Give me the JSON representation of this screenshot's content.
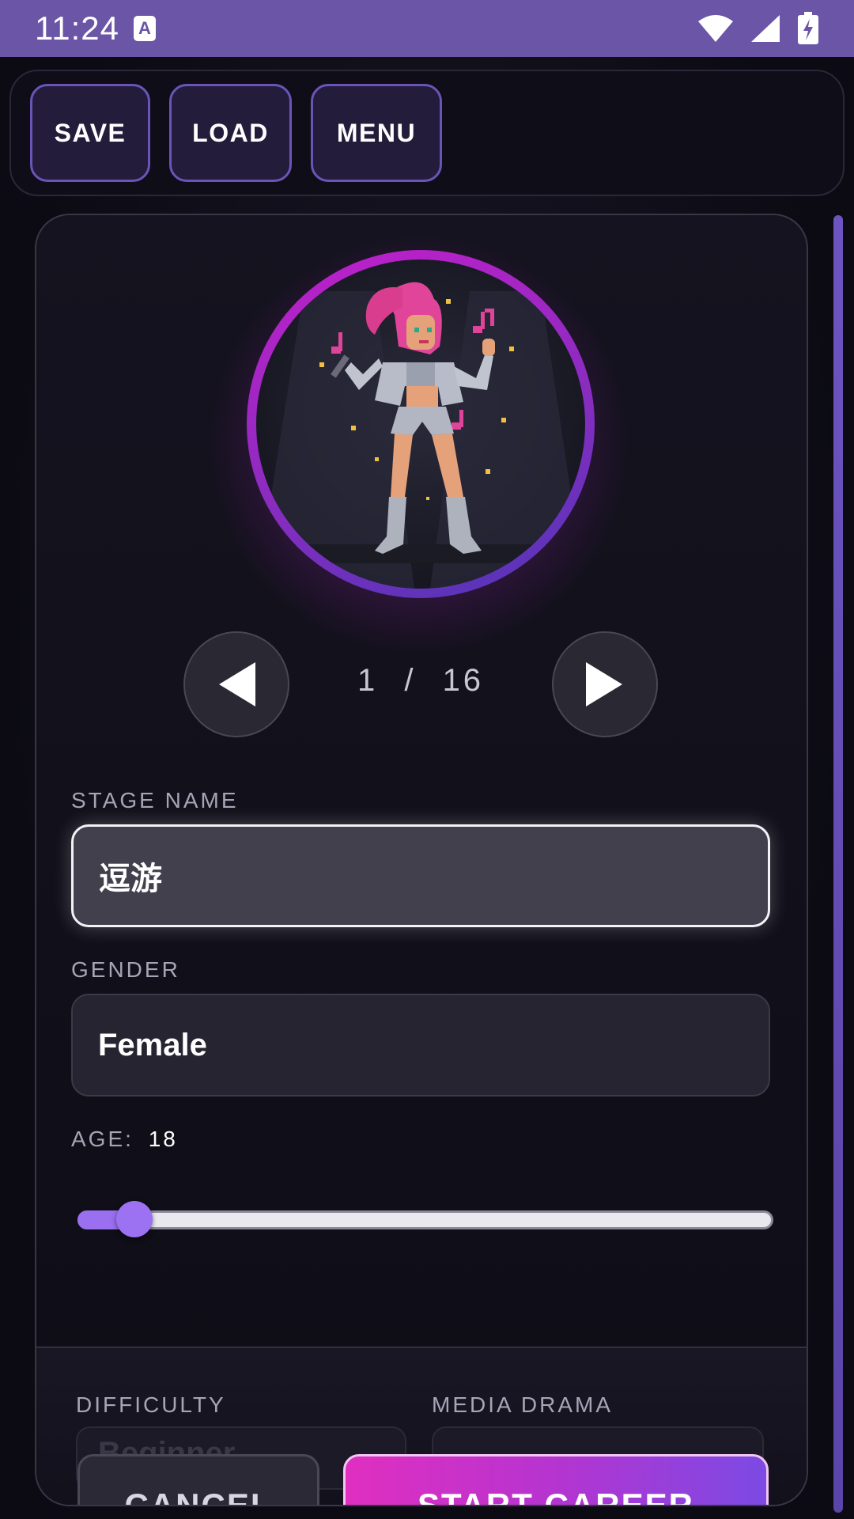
{
  "status_bar": {
    "time": "11:24",
    "notification_icon_letter": "A",
    "icons": [
      "wifi-icon",
      "signal-icon",
      "battery-charging-icon"
    ]
  },
  "toolbar": {
    "save_label": "SAVE",
    "load_label": "LOAD",
    "menu_label": "MENU"
  },
  "character": {
    "current_index": "1",
    "separator": "/",
    "total": "16"
  },
  "form": {
    "stage_name_label": "STAGE NAME",
    "stage_name_value": "逗游",
    "gender_label": "GENDER",
    "gender_value": "Female",
    "age_label": "AGE:",
    "age_value": "18",
    "age_slider_fraction": 0.07
  },
  "options": {
    "difficulty_label": "DIFFICULTY",
    "difficulty_value": "Beginner",
    "media_drama_label": "MEDIA DRAMA"
  },
  "actions": {
    "cancel_label": "CANCEL",
    "start_label": "START CAREER"
  },
  "colors": {
    "status_bar": "#6a55a6",
    "accent_purple": "#9a6ff0",
    "accent_magenta": "#e02fc0",
    "button_border": "#6b54b8"
  }
}
